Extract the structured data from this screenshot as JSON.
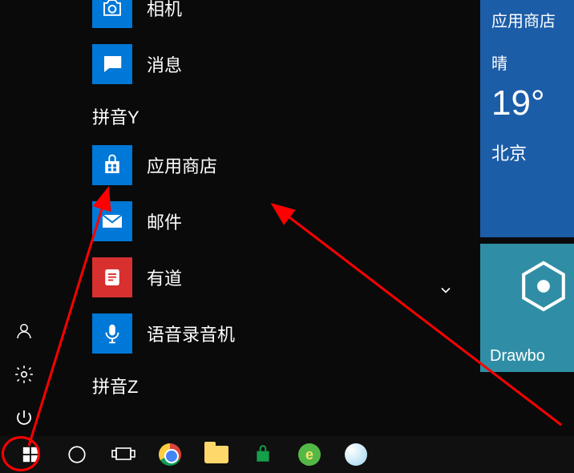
{
  "groups": {
    "pinyinY": "拼音Y",
    "pinyinZ": "拼音Z"
  },
  "apps": {
    "camera": "相机",
    "messages": "消息",
    "store": "应用商店",
    "mail": "邮件",
    "youdao": "有道",
    "voice": "语音录音机"
  },
  "weather": {
    "tile_title": "应用商店",
    "condition": "晴",
    "temp": "19°",
    "city": "北京"
  },
  "drawbo": {
    "label": "Drawbo"
  },
  "rail": {
    "account": "账户",
    "settings": "设置",
    "power": "电源"
  },
  "taskbar": {
    "start": "开始",
    "cortana": "Cortana",
    "taskview": "任务视图",
    "chrome": "Chrome",
    "explorer": "文件资源管理器",
    "store": "应用商店",
    "browser": "浏览器",
    "sogou": "搜狗"
  }
}
